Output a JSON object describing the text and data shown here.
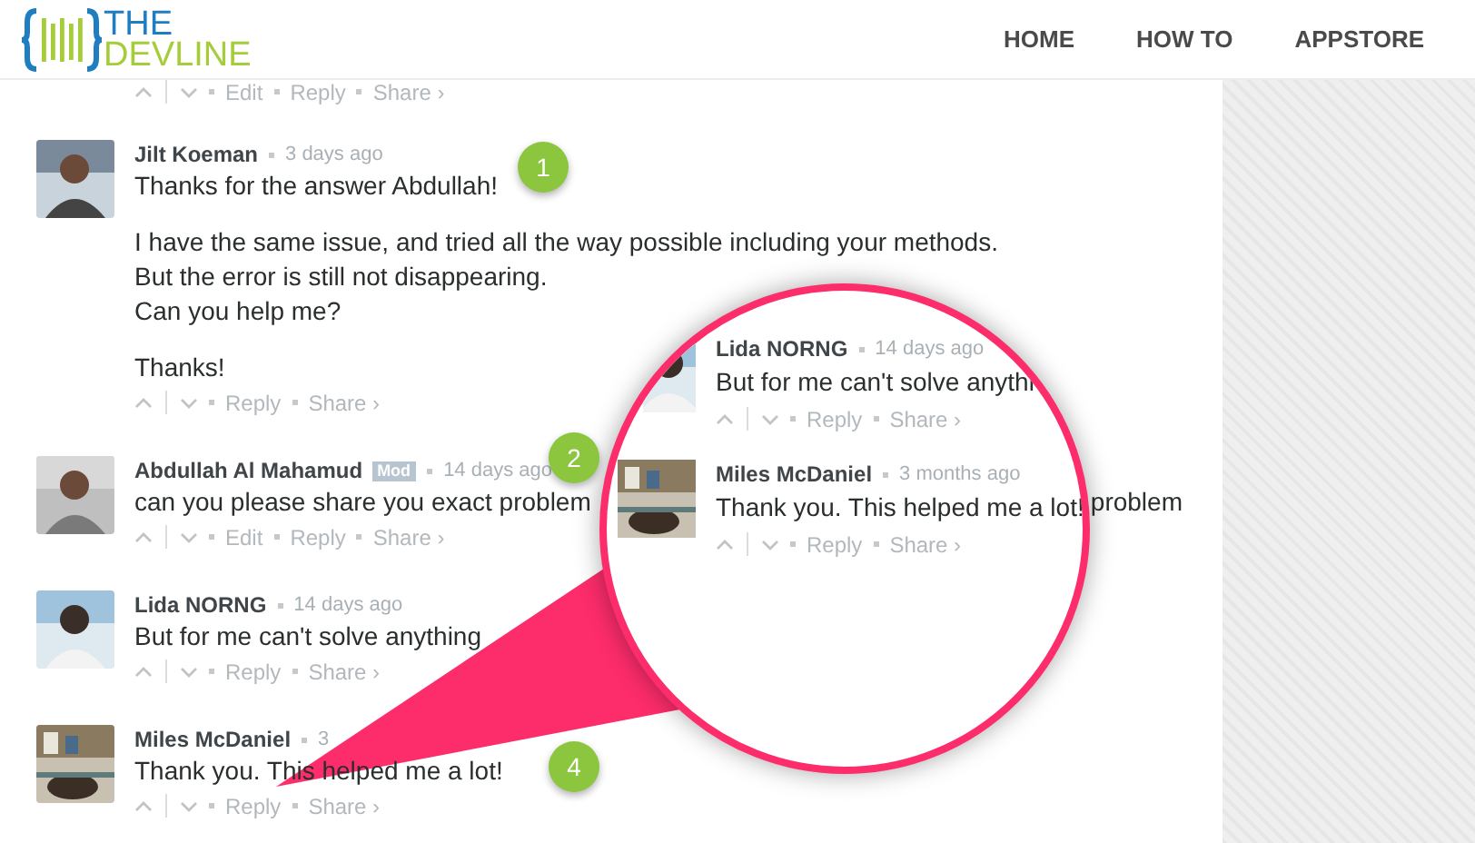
{
  "logo": {
    "top": "THE",
    "bottom": "DEVLINE"
  },
  "nav": [
    {
      "label": "HOME"
    },
    {
      "label": "HOW TO"
    },
    {
      "label": "APPSTORE"
    }
  ],
  "previous_actions": [
    "Edit",
    "Reply",
    "Share ›"
  ],
  "comments": [
    {
      "author": "Jilt Koeman",
      "time": "3 days ago",
      "paragraphs": [
        "Thanks for the answer Abdullah!",
        "I have the same issue, and tried all the way possible including your methods.\nBut the error is still not disappearing.\nCan you help me?",
        "Thanks!"
      ],
      "actions": [
        "Reply",
        "Share ›"
      ]
    },
    {
      "author": "Abdullah Al Mahamud",
      "tag": "Mod",
      "time": "14 days ago",
      "paragraphs": [
        "can you please share you exact problem"
      ],
      "tail": "problem",
      "actions": [
        "Edit",
        "Reply",
        "Share ›"
      ]
    },
    {
      "author": "Lida NORNG",
      "time": "14 days ago",
      "paragraphs": [
        "But for me can't solve anything"
      ],
      "actions": [
        "Reply",
        "Share ›"
      ]
    },
    {
      "author": "Miles McDaniel",
      "time": "3",
      "paragraphs": [
        "Thank you. This helped me a lot!"
      ],
      "actions": [
        "Reply",
        "Share ›"
      ]
    }
  ],
  "magnifier": {
    "comments": [
      {
        "author": "Lida NORNG",
        "time": "14 days ago",
        "text": "But for me can't solve anythi",
        "actions": [
          "Reply",
          "Share ›"
        ]
      },
      {
        "author": "Miles McDaniel",
        "time": "3 months ago",
        "text": "Thank you. This helped me a lot!",
        "actions": [
          "Reply",
          "Share ›"
        ]
      }
    ]
  },
  "annotations": [
    {
      "label": "1"
    },
    {
      "label": "2"
    },
    {
      "label": "4"
    }
  ]
}
